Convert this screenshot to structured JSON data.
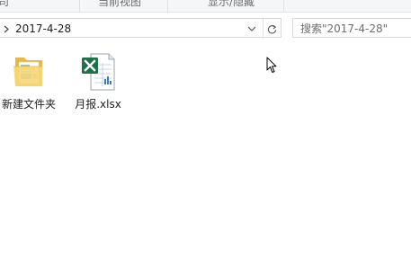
{
  "ribbon": {
    "groups": [
      {
        "label": "司"
      },
      {
        "label": "当前视图"
      },
      {
        "label": "显示/隐藏"
      }
    ]
  },
  "address_bar": {
    "path": "2017-4-28",
    "chevron_icon": "chevron-right-icon",
    "dropdown_icon": "chevron-down-icon",
    "refresh_icon": "refresh-icon"
  },
  "search": {
    "placeholder": "搜索\"2017-4-28\""
  },
  "files": [
    {
      "name": "新建文件夹",
      "icon": "folder-icon"
    },
    {
      "name": "月报.xlsx",
      "icon": "excel-file-icon"
    }
  ],
  "colors": {
    "folder": "#f7d774",
    "excel_green": "#1e7145",
    "border": "#d9d9d9"
  }
}
